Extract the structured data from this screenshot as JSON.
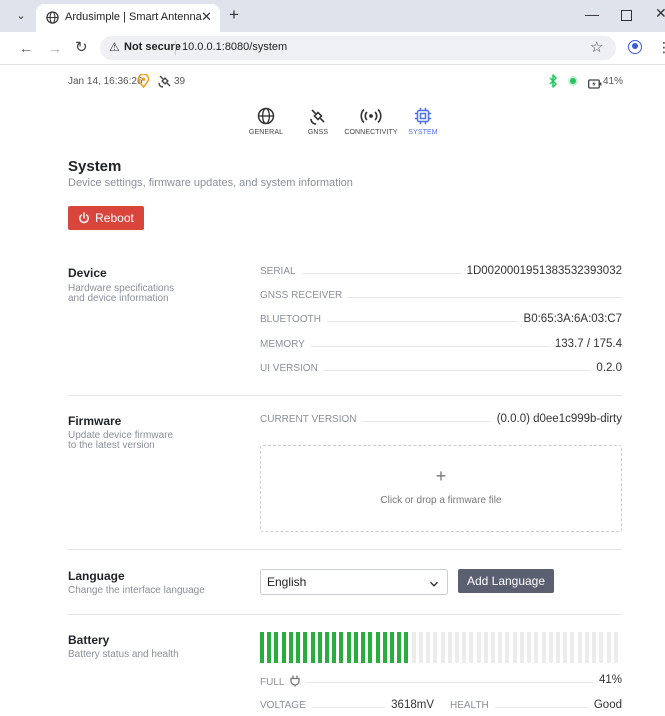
{
  "browser": {
    "tab_title": "Ardusimple | Smart Antenna",
    "security_label": "Not secure",
    "url": "10.0.0.1:8080/system"
  },
  "status_bar": {
    "datetime": "Jan 14, 16:36:26",
    "satellites": "39",
    "battery_percent": "41%",
    "status_dot_color": "#22c55e",
    "bluetooth_color": "#22c55e",
    "location_icon_color": "#f0a020"
  },
  "nav": {
    "items": [
      {
        "label": "GENERAL",
        "icon": "globe-icon"
      },
      {
        "label": "GNSS",
        "icon": "satellite-icon"
      },
      {
        "label": "CONNECTIVITY",
        "icon": "broadcast-icon"
      },
      {
        "label": "SYSTEM",
        "icon": "chip-icon"
      }
    ],
    "active": "SYSTEM",
    "active_color": "#4f6ee8"
  },
  "page": {
    "title": "System",
    "subtitle": "Device settings, firmware updates, and system information",
    "reboot_label": "Reboot",
    "reboot_color": "#d9453b"
  },
  "device": {
    "title": "Device",
    "desc_line1": "Hardware specifications",
    "desc_line2": "and device information",
    "rows": [
      {
        "label": "SERIAL",
        "value": "1D0020001951383532393032"
      },
      {
        "label": "GNSS RECEIVER",
        "value": ""
      },
      {
        "label": "BLUETOOTH",
        "value": "B0:65:3A:6A:03:C7"
      },
      {
        "label": "MEMORY",
        "value": "133.7 / 175.4"
      },
      {
        "label": "UI VERSION",
        "value": "0.2.0"
      }
    ]
  },
  "firmware": {
    "title": "Firmware",
    "desc_line1": "Update device firmware",
    "desc_line2": "to the latest version",
    "current_label": "CURRENT VERSION",
    "current_value": "(0.0.0) d0ee1c999b-dirty",
    "dropzone_text": "Click or drop a firmware file"
  },
  "language": {
    "title": "Language",
    "desc": "Change the interface language",
    "selected": "English",
    "add_label": "Add Language",
    "add_color": "#5b6070"
  },
  "battery": {
    "title": "Battery",
    "desc": "Battery status and health",
    "level_percent": 41,
    "bar_fill_color": "#27ae3c",
    "bar_empty_color": "#ececec",
    "state_label": "FULL",
    "percent_text": "41%",
    "voltage_label": "VOLTAGE",
    "voltage_value": "3618mV",
    "health_label": "HEALTH",
    "health_value": "Good"
  }
}
